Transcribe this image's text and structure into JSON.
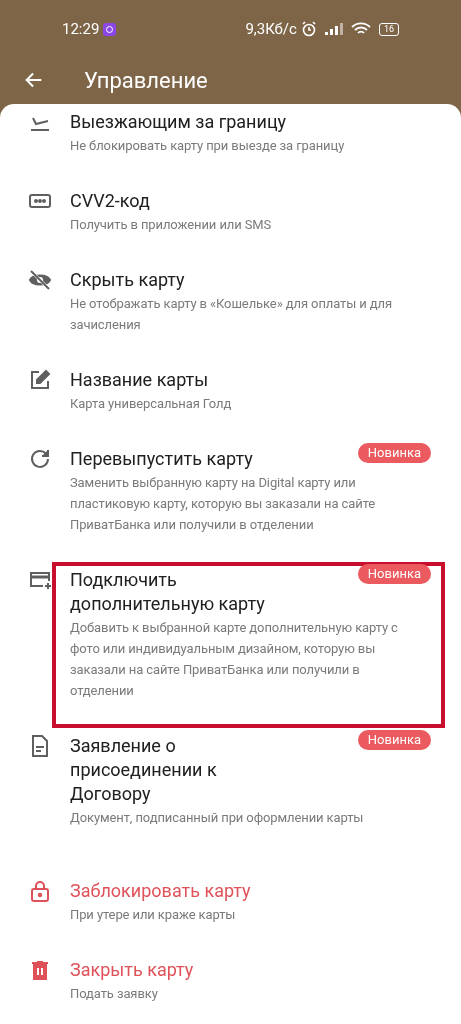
{
  "status_bar": {
    "time": "12:29",
    "network_speed": "9,3Кб/с",
    "battery": "16"
  },
  "header": {
    "title": "Управление"
  },
  "items": [
    {
      "title": "Выезжающим за границу",
      "subtitle": "Не блокировать карту при выезде за границу",
      "kind": "normal"
    },
    {
      "title": "CVV2-код",
      "subtitle": "Получить в приложении или SMS",
      "kind": "normal"
    },
    {
      "title": "Скрыть карту",
      "subtitle": "Не отображать карту в «Кошельке» для оплаты и для зачисления",
      "kind": "normal"
    },
    {
      "title": "Название карты",
      "subtitle": "Карта универсальная Голд",
      "kind": "normal"
    },
    {
      "title": "Перевыпустить карту",
      "subtitle": "Заменить выбранную карту на Digital карту или пластиковую карту, которую вы заказали на сайте ПриватБанка или получили в отделении",
      "badge": "Новинка",
      "kind": "normal"
    },
    {
      "title": "Подключить дополнительную карту",
      "subtitle": "Добавить к выбранной карте дополнительную карту с фото или индивидуальным дизайном, которую вы заказали на сайте ПриватБанка или получили в отделении",
      "badge": "Новинка",
      "kind": "normal",
      "highlighted": true
    },
    {
      "title": "Заявление о присоединении к Договору",
      "subtitle": "Документ, подписанный при оформлении карты",
      "badge": "Новинка",
      "kind": "normal"
    },
    {
      "title": "Заблокировать карту",
      "subtitle": "При утере или краже карты",
      "kind": "danger"
    },
    {
      "title": "Закрыть карту",
      "subtitle": "Подать заявку",
      "kind": "danger"
    }
  ]
}
